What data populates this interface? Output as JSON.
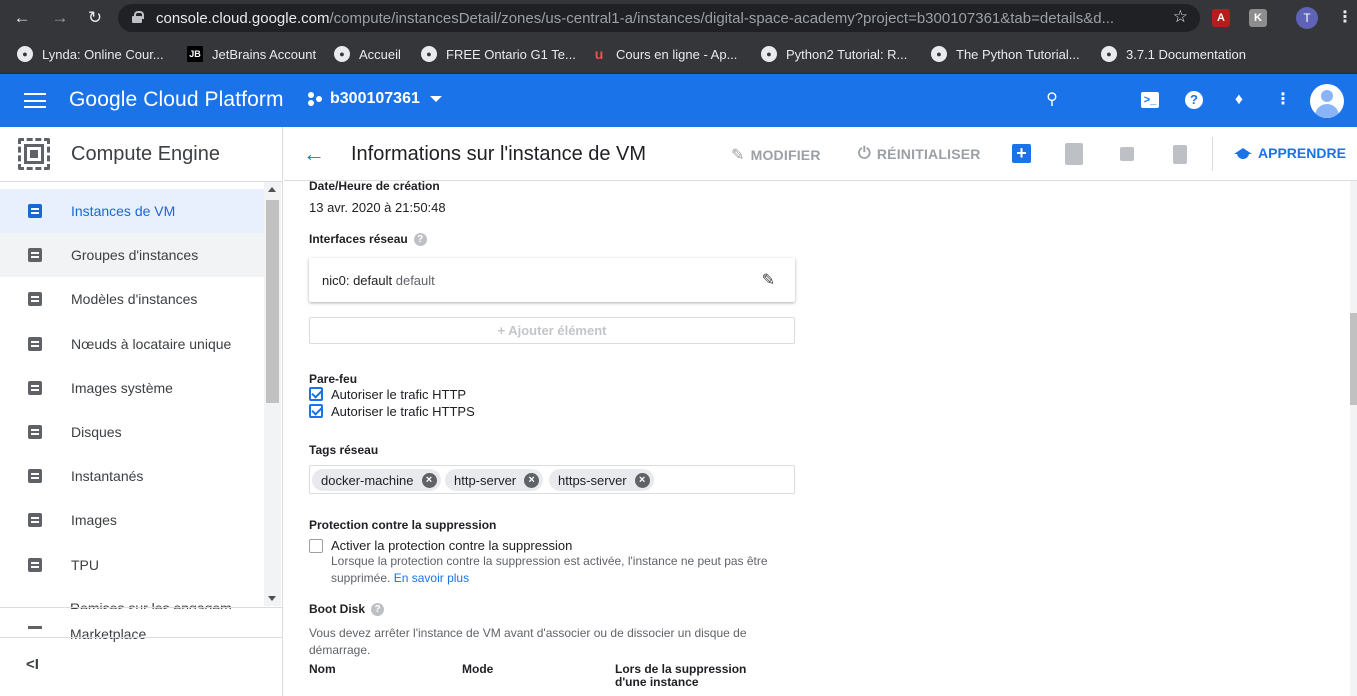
{
  "browser": {
    "url_host": "console.cloud.google.com",
    "url_path": "/compute/instancesDetail/zones/us-central1-a/instances/digital-space-academy?project=b300107361&tab=details&d...",
    "profile_initial": "T",
    "bookmarks": [
      {
        "label": "Lynda: Online Cour...",
        "icon": "globe-icon"
      },
      {
        "label": "JetBrains Account",
        "icon": "jetbrains-icon"
      },
      {
        "label": "Accueil",
        "icon": "globe-icon"
      },
      {
        "label": "FREE Ontario G1 Te...",
        "icon": "globe-icon"
      },
      {
        "label": "Cours en ligne - Ap...",
        "icon": "udemy-icon"
      },
      {
        "label": "Python2 Tutorial: R...",
        "icon": "globe-icon"
      },
      {
        "label": "The Python Tutorial...",
        "icon": "globe-icon"
      },
      {
        "label": "3.7.1 Documentation",
        "icon": "globe-icon"
      }
    ]
  },
  "header": {
    "brand": "Google Cloud Platform",
    "project": "b300107361"
  },
  "sidebar": {
    "title": "Compute Engine",
    "items": [
      {
        "label": "Instances de VM",
        "state": "active"
      },
      {
        "label": "Groupes d'instances",
        "state": "hover"
      },
      {
        "label": "Modèles d'instances",
        "state": ""
      },
      {
        "label": "Nœuds à locataire unique",
        "state": ""
      },
      {
        "label": "Images système",
        "state": ""
      },
      {
        "label": "Disques",
        "state": ""
      },
      {
        "label": "Instantanés",
        "state": ""
      },
      {
        "label": "Images",
        "state": ""
      },
      {
        "label": "TPU",
        "state": ""
      }
    ],
    "partial_item": "Remises sur les engagem",
    "marketplace": "Marketplace",
    "collapse": "<I"
  },
  "page": {
    "title": "Informations sur l'instance de VM",
    "toolbar": {
      "edit": "MODIFIER",
      "reset": "RÉINITIALISER",
      "learn": "APPRENDRE"
    }
  },
  "details": {
    "created_label": "Date/Heure de création",
    "created_value": "13 avr. 2020 à 21:50:48",
    "network_label": "Interfaces réseau",
    "nic_name": "nic0: default",
    "nic_network": "default",
    "add_item": "Ajouter élément",
    "firewall_label": "Pare-feu",
    "firewall": [
      {
        "label": "Autoriser le trafic HTTP",
        "checked": true
      },
      {
        "label": "Autoriser le trafic HTTPS",
        "checked": true
      }
    ],
    "tags_label": "Tags réseau",
    "tags": [
      "docker-machine",
      "http-server",
      "https-server"
    ],
    "deletion_label": "Protection contre la suppression",
    "deletion_checkbox": "Activer la protection contre la suppression",
    "deletion_checked": false,
    "deletion_desc": "Lorsque la protection contre la suppression est activée, l'instance ne peut pas être supprimée.",
    "deletion_link": "En savoir plus",
    "boot_label": "Boot Disk",
    "boot_desc": "Vous devez arrêter l'instance de VM avant d'associer ou de dissocier un disque de démarrage.",
    "columns": [
      "Nom",
      "Mode",
      "Lors de la suppression d'une instance"
    ]
  }
}
